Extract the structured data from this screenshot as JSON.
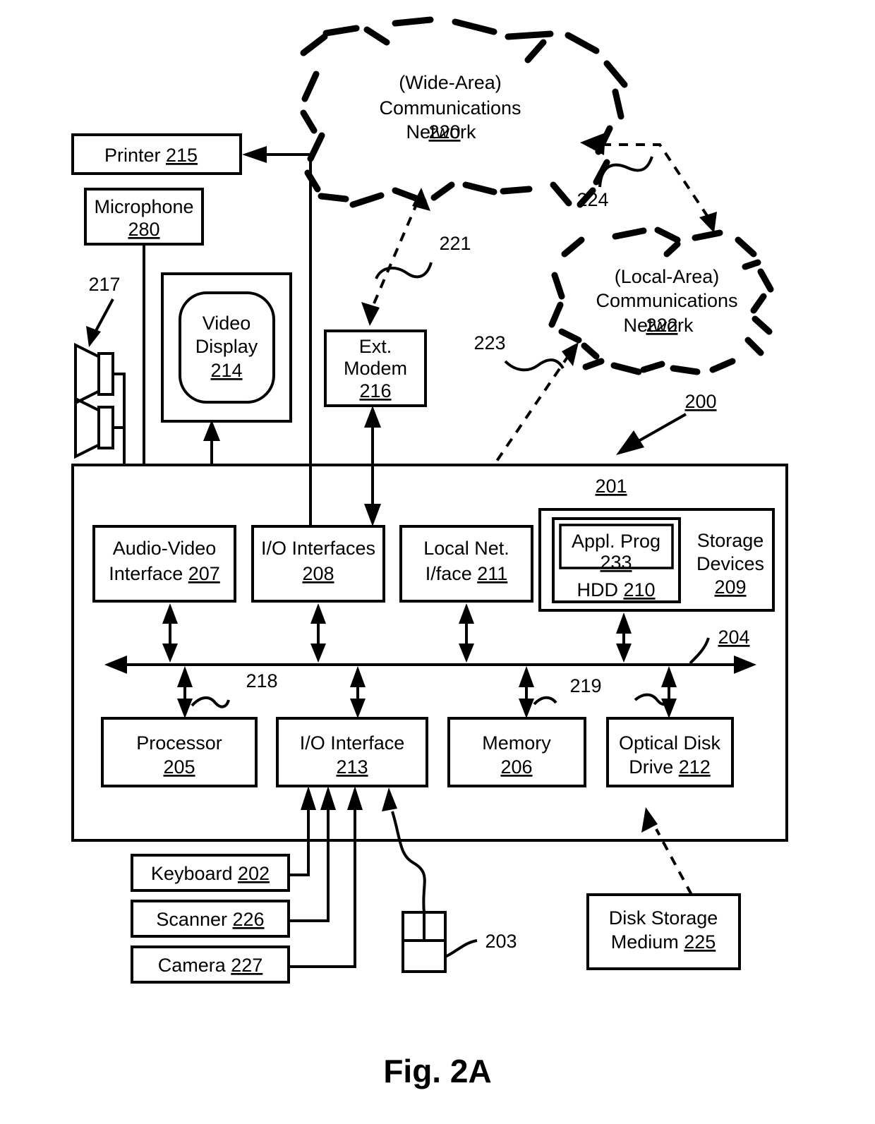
{
  "figure": {
    "caption": "Fig. 2A",
    "system_ref": "200",
    "computer_module_ref": "201",
    "bus_ref": "204"
  },
  "clouds": [
    {
      "id": "wan",
      "line1": "(Wide-Area)",
      "line2": "Communications",
      "line3": "Network ",
      "ref": "220"
    },
    {
      "id": "lan",
      "line1": "(Local-Area)",
      "line2": "Communications",
      "line3": "Network ",
      "ref": "222"
    }
  ],
  "peripherals": [
    {
      "id": "printer",
      "label": "Printer ",
      "ref": "215"
    },
    {
      "id": "microphone",
      "line1": "Microphone",
      "ref": "280"
    },
    {
      "id": "video-display",
      "line1": "Video",
      "line2": "Display",
      "ref": "214"
    },
    {
      "id": "ext-modem",
      "line1": "Ext.",
      "line2": "Modem",
      "ref": "216"
    },
    {
      "id": "keyboard",
      "label": "Keyboard ",
      "ref": "202"
    },
    {
      "id": "scanner",
      "label": "Scanner ",
      "ref": "226"
    },
    {
      "id": "camera",
      "label": "Camera ",
      "ref": "227"
    },
    {
      "id": "disk-storage-medium",
      "line1": "Disk Storage",
      "line2": "Medium ",
      "ref": "225"
    }
  ],
  "interfaces": [
    {
      "id": "audio-video-interface",
      "line1": "Audio-Video",
      "line2": "Interface ",
      "ref": "207"
    },
    {
      "id": "io-interfaces",
      "line1": "I/O Interfaces",
      "ref": "208"
    },
    {
      "id": "local-net-iface",
      "line1": "Local Net.",
      "line2": "I/face ",
      "ref": "211"
    }
  ],
  "storage": {
    "outer_label_1": "Storage",
    "outer_label_2": "Devices",
    "outer_ref": "209",
    "hdd_label": "HDD ",
    "hdd_ref": "210",
    "appl_prog_label": "Appl. Prog",
    "appl_prog_ref": "233"
  },
  "core_components": [
    {
      "id": "processor",
      "line1": "Processor",
      "ref": "205"
    },
    {
      "id": "io-interface",
      "line1": "I/O Interface",
      "ref": "213"
    },
    {
      "id": "memory",
      "line1": "Memory",
      "ref": "206"
    },
    {
      "id": "optical-disk-drive",
      "line1": "Optical Disk",
      "line2": "Drive ",
      "ref": "212"
    }
  ],
  "reference_numerals": {
    "speakers": "217",
    "mouse": "203",
    "wan_link": "221",
    "lan_link": "223",
    "inter_network_link": "224",
    "bus_left": "218",
    "bus_right": "219",
    "bus": "204",
    "system": "200",
    "computer_module": "201"
  },
  "colors": {
    "stroke": "#000000",
    "background": "#ffffff"
  }
}
